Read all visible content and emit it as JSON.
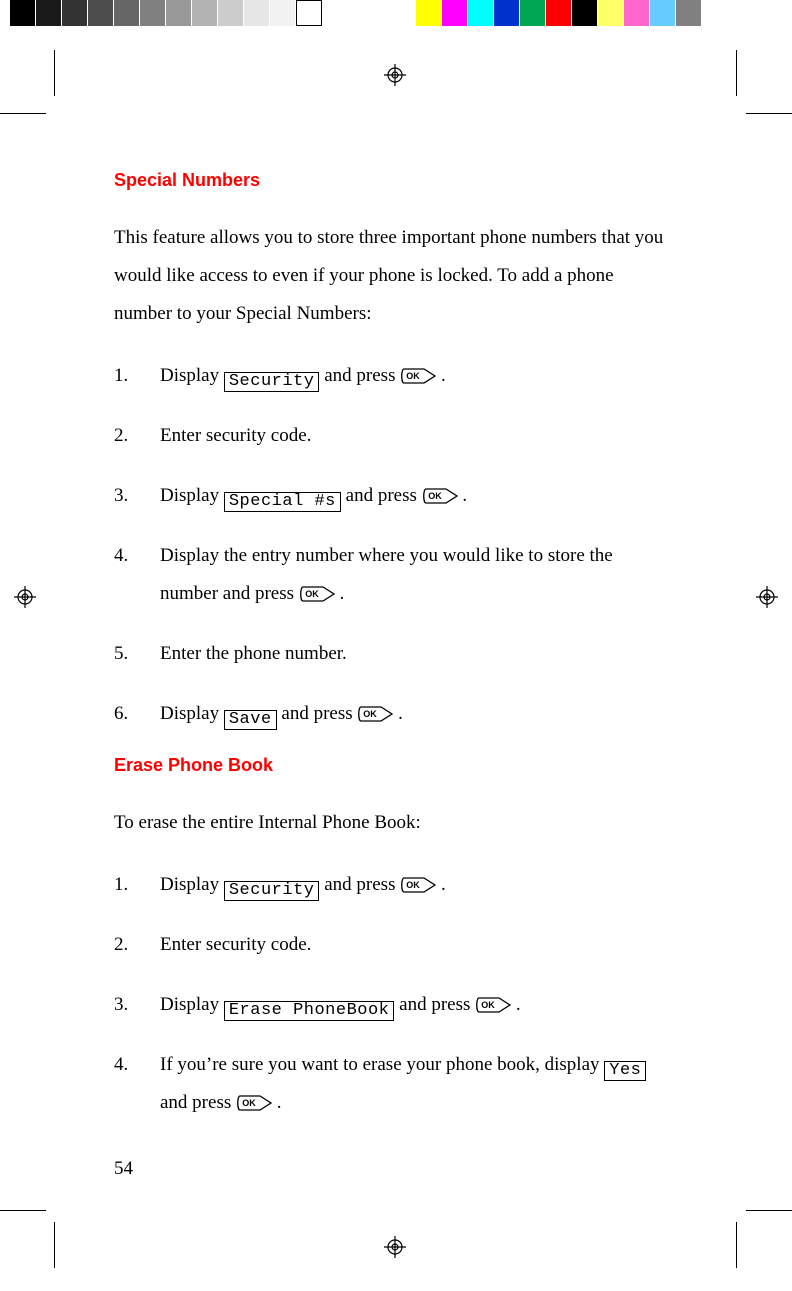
{
  "page_number": "54",
  "section1": {
    "title": "Special Numbers",
    "intro": "This feature allows you to store three important phone numbers that you would like access to even if your phone is locked. To add a phone number to your Special Numbers:",
    "steps": [
      {
        "n": "1.",
        "before": "Display ",
        "menu": "Security",
        "mid": " and press ",
        "after": "."
      },
      {
        "n": "2.",
        "text": "Enter security code."
      },
      {
        "n": "3.",
        "before": "Display ",
        "menu": "Special #s",
        "mid": " and press ",
        "after": "."
      },
      {
        "n": "4.",
        "before": "Display the entry number where you would like to store the number and press ",
        "after": "."
      },
      {
        "n": "5.",
        "text": "Enter the phone number."
      },
      {
        "n": "6.",
        "before": "Display ",
        "menu": "Save",
        "mid": " and press ",
        "after": "."
      }
    ]
  },
  "section2": {
    "title": "Erase Phone Book",
    "intro": "To erase the entire Internal Phone Book:",
    "steps": [
      {
        "n": "1.",
        "before": "Display ",
        "menu": "Security",
        "mid": " and press ",
        "after": "."
      },
      {
        "n": "2.",
        "text": "Enter security code."
      },
      {
        "n": "3.",
        "before": "Display ",
        "menu": "Erase PhoneBook",
        "mid": " and press ",
        "after": "."
      },
      {
        "n": "4.",
        "before": "If you’re sure you want to erase your phone book, display ",
        "menu": "Yes",
        "mid": " and press ",
        "after": "."
      }
    ]
  },
  "ok_label": "OK",
  "colors": {
    "gray_bar": [
      "#000000",
      "#1a1a1a",
      "#333333",
      "#4d4d4d",
      "#666666",
      "#808080",
      "#999999",
      "#b3b3b3",
      "#cccccc",
      "#e6e6e6",
      "#f2f2f2",
      "#ffffff"
    ],
    "color_bar": [
      "#ffff00",
      "#ff00ff",
      "#00ffff",
      "#0033cc",
      "#00a651",
      "#ff0000",
      "#000000",
      "#ffff66",
      "#ff66cc",
      "#66ccff",
      "#808080"
    ]
  }
}
